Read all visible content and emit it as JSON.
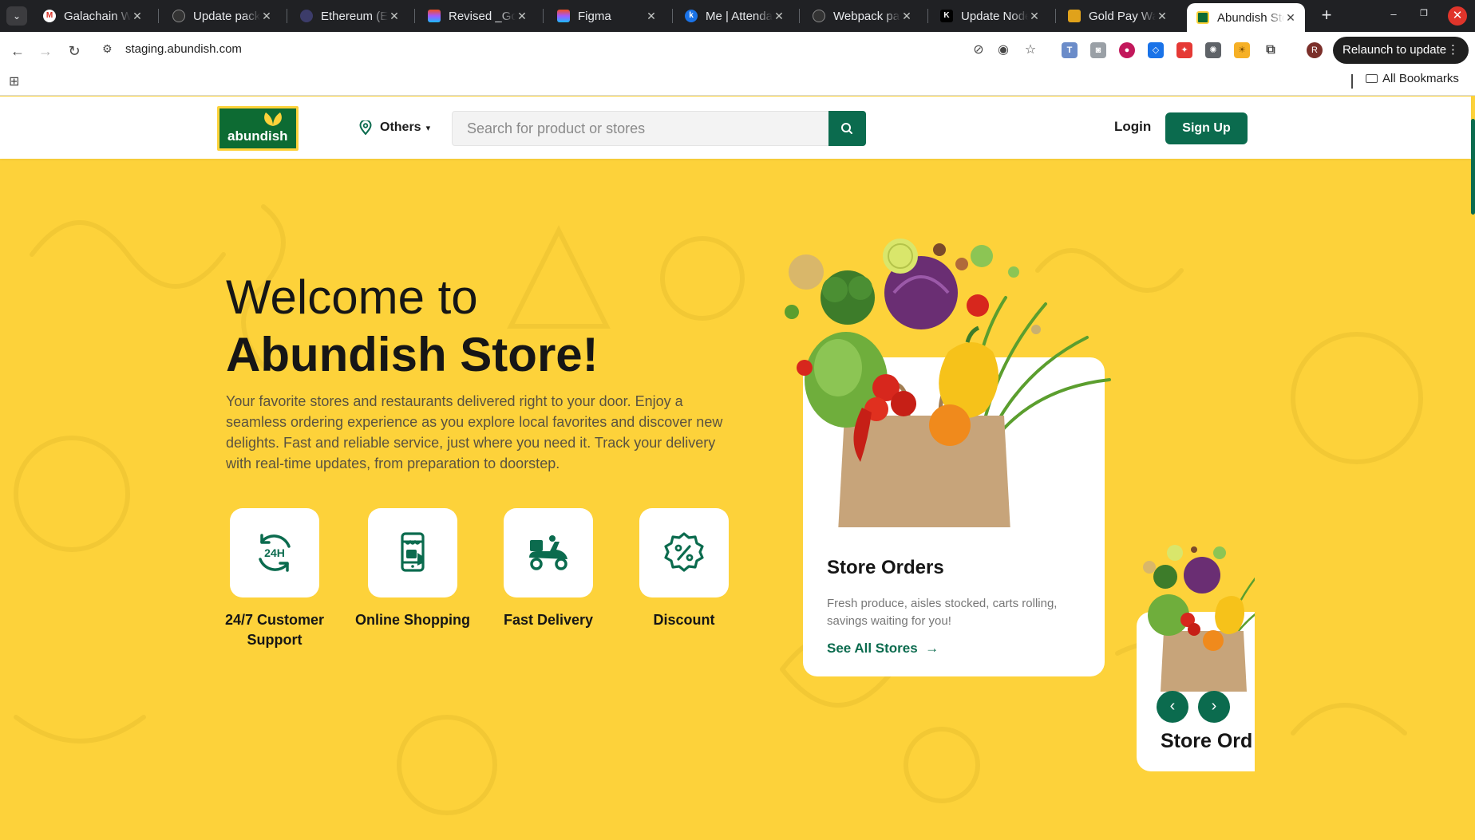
{
  "browser": {
    "tabs": [
      {
        "title": "Galachain Wallet",
        "favicon": "gmail-icon"
      },
      {
        "title": "Update packages",
        "favicon": "github-icon"
      },
      {
        "title": "Ethereum (ETH)",
        "favicon": "ethereum-icon"
      },
      {
        "title": "Revised _Gold",
        "favicon": "figma-icon"
      },
      {
        "title": "Figma",
        "favicon": "figma-icon"
      },
      {
        "title": "Me | Attendance",
        "favicon": "k-icon"
      },
      {
        "title": "Webpack path",
        "favicon": "github-icon"
      },
      {
        "title": "Update Node",
        "favicon": "k-icon"
      },
      {
        "title": "Gold Pay Wallet",
        "favicon": "gold-icon"
      },
      {
        "title": "Abundish Store",
        "favicon": "abundish-icon",
        "active": true
      }
    ],
    "url": "staging.abundish.com",
    "relaunch_label": "Relaunch to update",
    "avatar_letter": "R",
    "bookmarks_label": "All Bookmarks"
  },
  "header": {
    "logo_text": "abundish",
    "location_label": "Others",
    "search_placeholder": "Search for product or stores",
    "login_label": "Login",
    "signup_label": "Sign Up"
  },
  "hero": {
    "title_line1": "Welcome to",
    "title_line2": "Abundish Store!",
    "description": "Your favorite stores and restaurants delivered right to your door. Enjoy a seamless ordering experience as you explore local favorites and discover new delights. Fast and reliable service, just where you need it. Track your delivery with real-time updates, from preparation to doorstep."
  },
  "features": [
    {
      "label": "24/7 Customer Support",
      "icon": "24h-support-icon"
    },
    {
      "label": "Online Shopping",
      "icon": "mobile-shopping-icon"
    },
    {
      "label": "Fast Delivery",
      "icon": "delivery-scooter-icon"
    },
    {
      "label": "Discount",
      "icon": "discount-badge-icon"
    }
  ],
  "carousel": {
    "cards": [
      {
        "title": "Store Orders",
        "description": "Fresh produce, aisles stocked, carts rolling, savings waiting for you!",
        "link": "See All Stores"
      },
      {
        "title": "Store Ord"
      }
    ]
  },
  "colors": {
    "brand_green": "#0b6b4e",
    "brand_yellow": "#fdd23a",
    "logo_green": "#0d6b33"
  }
}
